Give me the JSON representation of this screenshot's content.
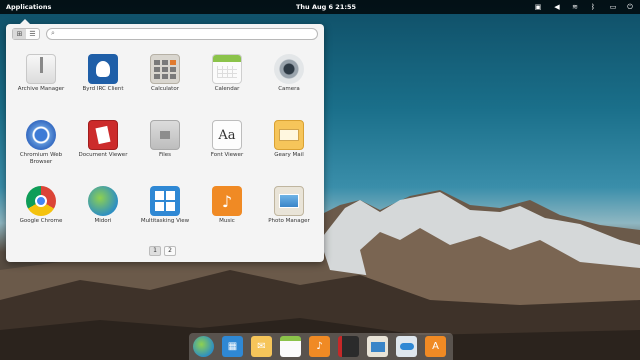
{
  "panel": {
    "applications_label": "Applications",
    "clock": "Thu Aug  6   21:55",
    "indicators": [
      "keyboard-icon",
      "volume-icon",
      "wifi-icon",
      "bluetooth-icon",
      "battery-icon",
      "power-icon"
    ]
  },
  "launcher": {
    "view_modes": [
      "grid-view-icon",
      "category-view-icon"
    ],
    "search_placeholder": "",
    "apps": [
      {
        "label": "Archive Manager",
        "icon": "archive-icon"
      },
      {
        "label": "Byrd IRC Client",
        "icon": "byrd-icon"
      },
      {
        "label": "Calculator",
        "icon": "calculator-icon"
      },
      {
        "label": "Calendar",
        "icon": "calendar-icon"
      },
      {
        "label": "Camera",
        "icon": "camera-icon"
      },
      {
        "label": "Chromium Web Browser",
        "icon": "chromium-icon"
      },
      {
        "label": "Document Viewer",
        "icon": "document-viewer-icon"
      },
      {
        "label": "Files",
        "icon": "files-icon"
      },
      {
        "label": "Font Viewer",
        "icon": "font-viewer-icon"
      },
      {
        "label": "Geary Mail",
        "icon": "mail-icon"
      },
      {
        "label": "Google Chrome",
        "icon": "chrome-icon"
      },
      {
        "label": "Midori",
        "icon": "midori-icon"
      },
      {
        "label": "Multitasking View",
        "icon": "multitasking-icon"
      },
      {
        "label": "Music",
        "icon": "music-icon"
      },
      {
        "label": "Photo Manager",
        "icon": "photo-manager-icon"
      }
    ],
    "pages": [
      "1",
      "2"
    ],
    "current_page": "1"
  },
  "dock": {
    "items": [
      "midori-icon",
      "multitasking-icon",
      "mail-icon",
      "calendar-icon",
      "music-icon",
      "video-icon",
      "photo-manager-icon",
      "settings-icon",
      "appcenter-icon"
    ]
  }
}
